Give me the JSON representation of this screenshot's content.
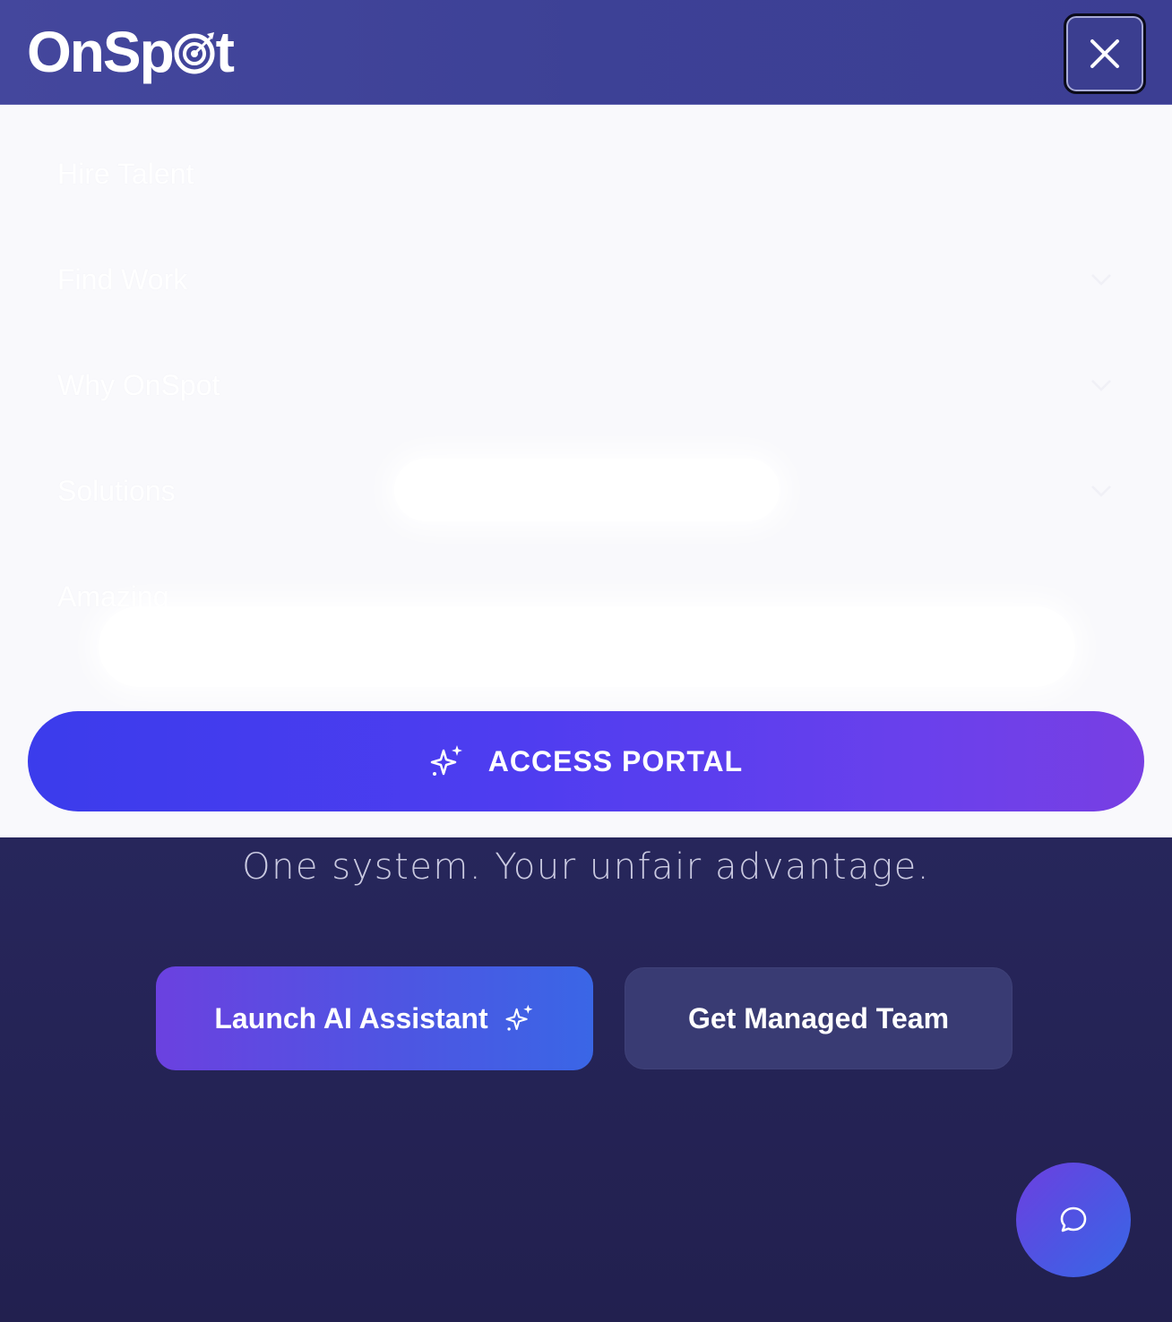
{
  "brand": {
    "logo_text_before": "OnSp",
    "logo_text_after": "t"
  },
  "header": {
    "close_icon": "close-icon"
  },
  "menu": {
    "items": [
      {
        "label": "Hire Talent",
        "has_chevron": false
      },
      {
        "label": "Find Work",
        "has_chevron": true
      },
      {
        "label": "Why OnSpot",
        "has_chevron": true
      },
      {
        "label": "Solutions",
        "has_chevron": true
      },
      {
        "label": "Amazing",
        "has_chevron": false
      }
    ],
    "portal_button": {
      "label": "ACCESS PORTAL",
      "icon": "sparkle-icon"
    }
  },
  "hero": {
    "tagline": "One system. Your unfair advantage.",
    "primary_button": {
      "label": "Launch AI Assistant",
      "icon": "sparkle-icon"
    },
    "secondary_button": {
      "label": "Get Managed Team"
    }
  },
  "chat": {
    "icon": "chat-bubble-icon"
  },
  "colors": {
    "header_bg": "#3d4196",
    "accent_start": "#3b3cec",
    "accent_end": "#783fe3",
    "hero_bg": "#2a2a63"
  }
}
